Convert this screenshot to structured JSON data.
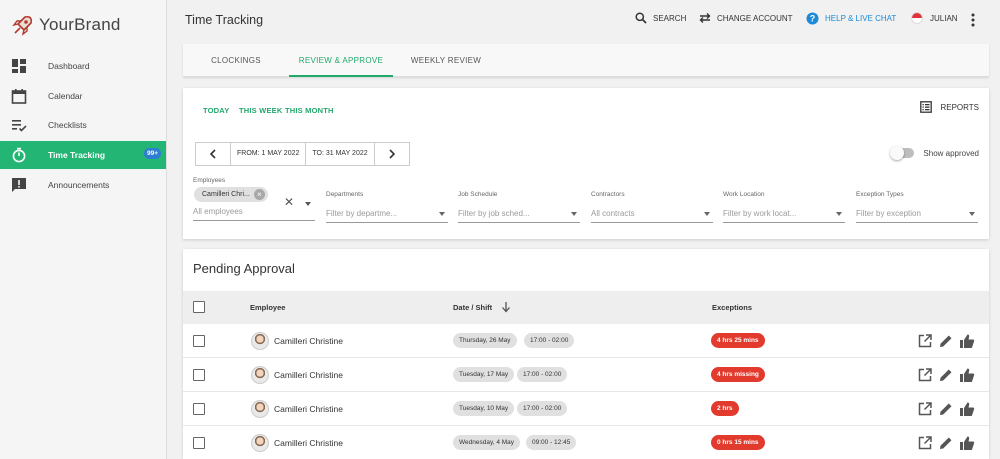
{
  "brand": {
    "name": "YourBrand"
  },
  "sidebar": {
    "items": [
      {
        "label": "Dashboard",
        "icon": "dashboard-icon"
      },
      {
        "label": "Calendar",
        "icon": "calendar-icon"
      },
      {
        "label": "Checklists",
        "icon": "checklist-icon"
      },
      {
        "label": "Time Tracking",
        "icon": "stopwatch-icon",
        "badge": "99+",
        "active": true
      },
      {
        "label": "Announcements",
        "icon": "announcement-icon"
      }
    ]
  },
  "topbar": {
    "title": "Time Tracking",
    "search": "SEARCH",
    "change_account": "CHANGE ACCOUNT",
    "help": "HELP & LIVE CHAT",
    "user": "JULIAN"
  },
  "tabs": [
    {
      "label": "CLOCKINGS"
    },
    {
      "label": "REVIEW & APPROVE",
      "active": true
    },
    {
      "label": "WEEKLY REVIEW"
    }
  ],
  "filters": {
    "ranges": [
      "TODAY",
      "THIS WEEK",
      "THIS MONTH"
    ],
    "reports": "REPORTS",
    "from": "FROM: 1 MAY 2022",
    "to": "TO: 31 MAY 2022",
    "show_approved": "Show approved",
    "employees": {
      "label": "Employees",
      "chip": "Camilleri Chri...",
      "placeholder": "All employees"
    },
    "departments": {
      "label": "Departments",
      "placeholder": "Filter by departme..."
    },
    "job_schedule": {
      "label": "Job Schedule",
      "placeholder": "Filter by job sched..."
    },
    "contractors": {
      "label": "Contractors",
      "placeholder": "All contracts"
    },
    "work_location": {
      "label": "Work Location",
      "placeholder": "Filter by work locat..."
    },
    "exception_types": {
      "label": "Exception Types",
      "placeholder": "Filter by exception"
    }
  },
  "pending": {
    "title": "Pending Approval",
    "columns": {
      "employee": "Employee",
      "date_shift": "Date / Shift",
      "exceptions": "Exceptions"
    },
    "rows": [
      {
        "employee": "Camilleri Christine",
        "date": "Thursday, 26 May",
        "shift": "17:00 - 02:00",
        "exception": "4 hrs 25 mins"
      },
      {
        "employee": "Camilleri Christine",
        "date": "Tuesday, 17 May",
        "shift": "17:00 - 02:00",
        "exception": "4 hrs missing"
      },
      {
        "employee": "Camilleri Christine",
        "date": "Tuesday, 10 May",
        "shift": "17:00 - 02:00",
        "exception": "2 hrs"
      },
      {
        "employee": "Camilleri Christine",
        "date": "Wednesday, 4 May",
        "shift": "09:00 - 12:45",
        "exception": "0 hrs 15 mins"
      }
    ]
  },
  "colors": {
    "accent": "#22a86b",
    "help": "#1c8ad6",
    "danger": "#e23b2e",
    "badge": "#2d7dd2"
  }
}
